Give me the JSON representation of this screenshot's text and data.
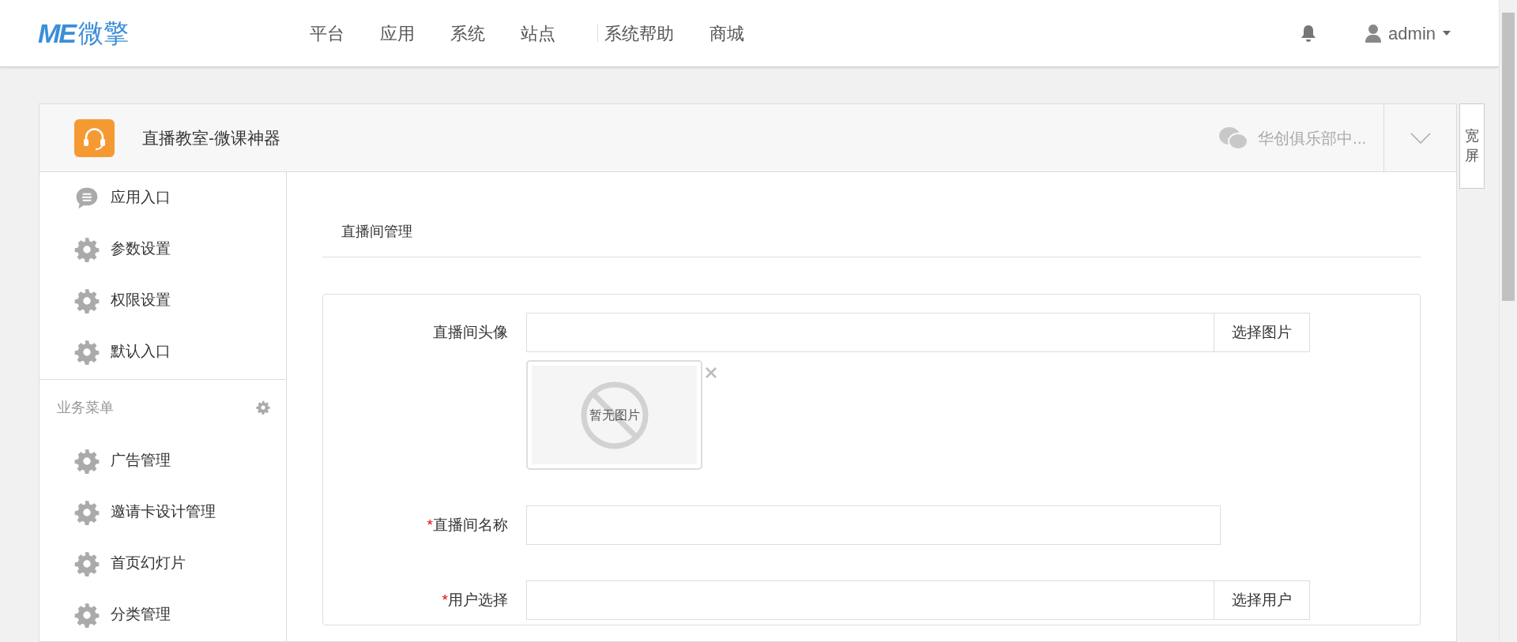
{
  "logo": {
    "mark": "ME",
    "name": "微擎"
  },
  "nav_groups": [
    [
      {
        "label": "平台"
      },
      {
        "label": "应用"
      },
      {
        "label": "系统"
      },
      {
        "label": "站点"
      }
    ],
    [
      {
        "label": "系统帮助"
      },
      {
        "label": "商城"
      }
    ]
  ],
  "user": {
    "name": "admin"
  },
  "app": {
    "title": "直播教室-微课神器",
    "account": "华创俱乐部中...",
    "wide_button": "宽屏"
  },
  "sidebar": {
    "items": [
      {
        "label": "应用入口",
        "kind": "chat"
      },
      {
        "label": "参数设置",
        "kind": "gear"
      },
      {
        "label": "权限设置",
        "kind": "gear"
      },
      {
        "label": "默认入口",
        "kind": "gear"
      }
    ],
    "sections": [
      {
        "title": "业务菜单",
        "items": [
          {
            "label": "广告管理",
            "kind": "gear"
          },
          {
            "label": "邀请卡设计管理",
            "kind": "gear"
          },
          {
            "label": "首页幻灯片",
            "kind": "gear"
          },
          {
            "label": "分类管理",
            "kind": "gear"
          }
        ]
      }
    ]
  },
  "content": {
    "title": "直播间管理",
    "required_mark": "*",
    "form": [
      {
        "kind": "upload",
        "label": "直播间头像",
        "required": false,
        "button": "选择图片",
        "preview": "暂无图片"
      },
      {
        "kind": "text",
        "label": "直播间名称",
        "required": true
      },
      {
        "kind": "picker",
        "label": "用户选择",
        "required": true,
        "button": "选择用户"
      }
    ]
  }
}
